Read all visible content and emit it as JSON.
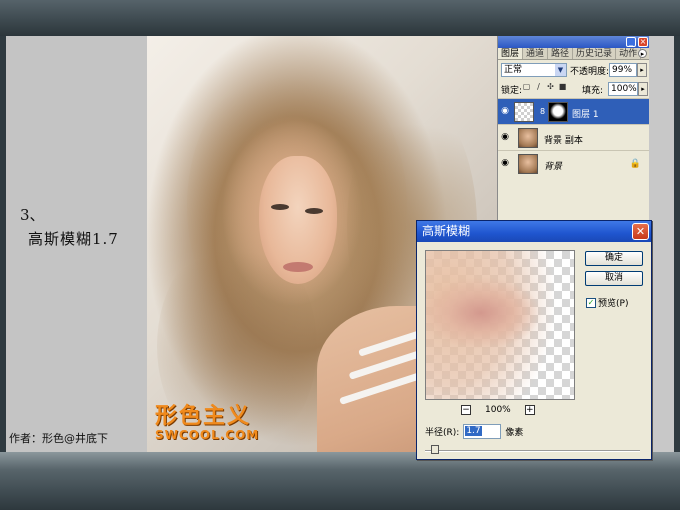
{
  "slide": {
    "step_number": "3、",
    "step_text": "高斯模糊1.7",
    "author": "作者：形色@井底下"
  },
  "photo": {
    "logo_main": "形色主义",
    "logo_sub": "SWCOOL.COM"
  },
  "layers_panel": {
    "tabs": [
      {
        "label": "图层",
        "active": true
      },
      {
        "label": "通道",
        "active": false
      },
      {
        "label": "路径",
        "active": false
      },
      {
        "label": "历史记录",
        "active": false
      },
      {
        "label": "动作",
        "active": false
      }
    ],
    "blend_mode": "正常",
    "opacity_label": "不透明度:",
    "opacity_value": "99%",
    "lock_label": "锁定:",
    "fill_label": "填充:",
    "fill_value": "100%",
    "layers": [
      {
        "name": "图层 1",
        "selected": true,
        "has_mask": true,
        "locked": false
      },
      {
        "name": "背景 副本",
        "selected": false,
        "has_mask": false,
        "locked": false
      },
      {
        "name": "背景",
        "selected": false,
        "has_mask": false,
        "locked": true
      }
    ]
  },
  "dialog": {
    "title": "高斯模糊",
    "ok_label": "确定",
    "cancel_label": "取消",
    "preview_label": "预览(P)",
    "preview_checked": true,
    "zoom_value": "100%",
    "radius_label": "半径(R):",
    "radius_value": "1.7",
    "radius_unit": "像素"
  },
  "colors": {
    "titlebar_blue": "#1f55cf",
    "selected_layer": "#2f5fb8",
    "logo_orange": "#f08a1c"
  }
}
